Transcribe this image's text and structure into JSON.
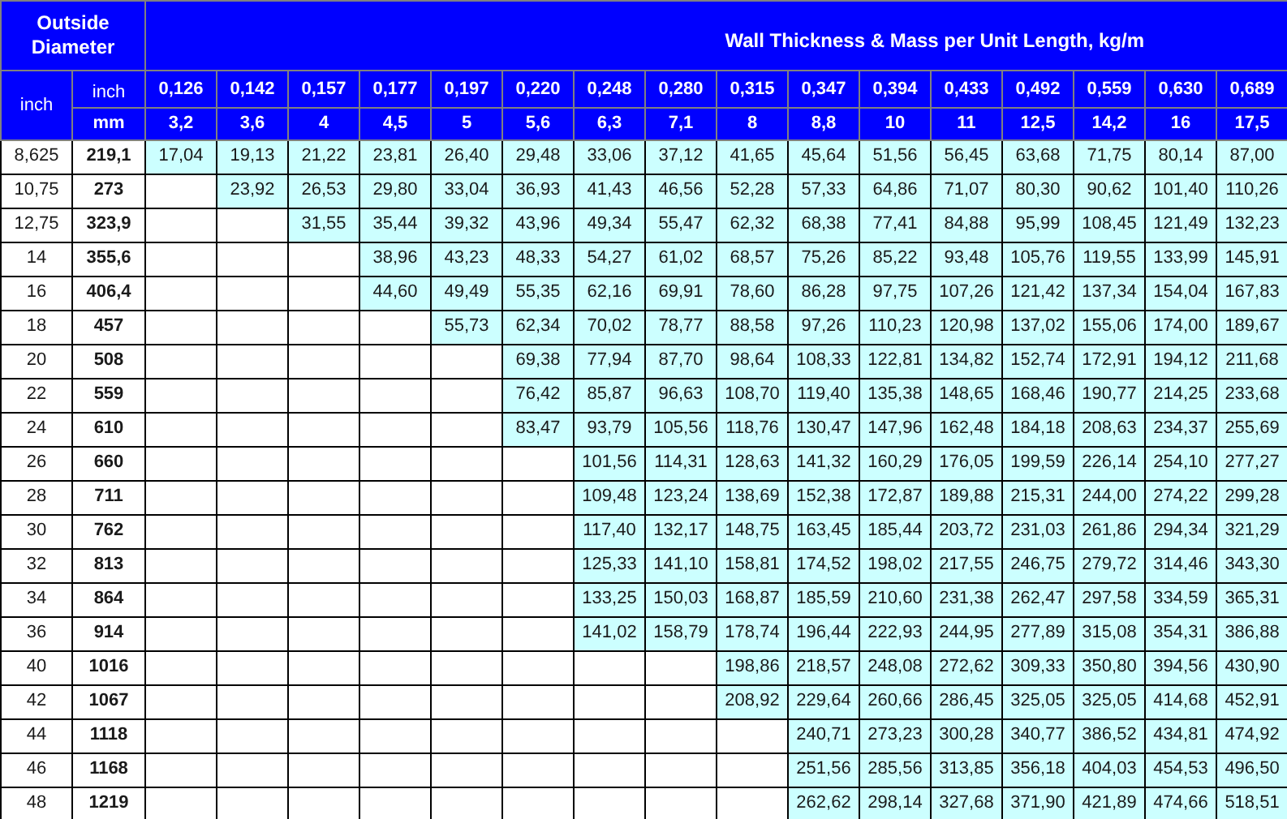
{
  "header": {
    "diameter_title": "Outside Diameter",
    "wall_title": "Wall Thickness & Mass per Unit Length, kg/m",
    "diameter_unit": "inch",
    "inch_label": "inch",
    "mm_label": "mm"
  },
  "thickness": [
    {
      "inch": "0,126",
      "mm": "3,2"
    },
    {
      "inch": "0,142",
      "mm": "3,6"
    },
    {
      "inch": "0,157",
      "mm": "4"
    },
    {
      "inch": "0,177",
      "mm": "4,5"
    },
    {
      "inch": "0,197",
      "mm": "5"
    },
    {
      "inch": "0,220",
      "mm": "5,6"
    },
    {
      "inch": "0,248",
      "mm": "6,3"
    },
    {
      "inch": "0,280",
      "mm": "7,1"
    },
    {
      "inch": "0,315",
      "mm": "8"
    },
    {
      "inch": "0,347",
      "mm": "8,8"
    },
    {
      "inch": "0,394",
      "mm": "10"
    },
    {
      "inch": "0,433",
      "mm": "11"
    },
    {
      "inch": "0,492",
      "mm": "12,5"
    },
    {
      "inch": "0,559",
      "mm": "14,2"
    },
    {
      "inch": "0,630",
      "mm": "16"
    },
    {
      "inch": "0,689",
      "mm": "17,5"
    }
  ],
  "rows": [
    {
      "inch": "8,625",
      "mm": "219,1",
      "cells": [
        "17,04",
        "19,13",
        "21,22",
        "23,81",
        "26,40",
        "29,48",
        "33,06",
        "37,12",
        "41,65",
        "45,64",
        "51,56",
        "56,45",
        "63,68",
        "71,75",
        "80,14",
        "87,00"
      ]
    },
    {
      "inch": "10,75",
      "mm": "273",
      "cells": [
        null,
        "23,92",
        "26,53",
        "29,80",
        "33,04",
        "36,93",
        "41,43",
        "46,56",
        "52,28",
        "57,33",
        "64,86",
        "71,07",
        "80,30",
        "90,62",
        "101,40",
        "110,26"
      ]
    },
    {
      "inch": "12,75",
      "mm": "323,9",
      "cells": [
        null,
        null,
        "31,55",
        "35,44",
        "39,32",
        "43,96",
        "49,34",
        "55,47",
        "62,32",
        "68,38",
        "77,41",
        "84,88",
        "95,99",
        "108,45",
        "121,49",
        "132,23"
      ]
    },
    {
      "inch": "14",
      "mm": "355,6",
      "cells": [
        null,
        null,
        null,
        "38,96",
        "43,23",
        "48,33",
        "54,27",
        "61,02",
        "68,57",
        "75,26",
        "85,22",
        "93,48",
        "105,76",
        "119,55",
        "133,99",
        "145,91"
      ]
    },
    {
      "inch": "16",
      "mm": "406,4",
      "cells": [
        null,
        null,
        null,
        "44,60",
        "49,49",
        "55,35",
        "62,16",
        "69,91",
        "78,60",
        "86,28",
        "97,75",
        "107,26",
        "121,42",
        "137,34",
        "154,04",
        "167,83"
      ]
    },
    {
      "inch": "18",
      "mm": "457",
      "cells": [
        null,
        null,
        null,
        null,
        "55,73",
        "62,34",
        "70,02",
        "78,77",
        "88,58",
        "97,26",
        "110,23",
        "120,98",
        "137,02",
        "155,06",
        "174,00",
        "189,67"
      ]
    },
    {
      "inch": "20",
      "mm": "508",
      "cells": [
        null,
        null,
        null,
        null,
        null,
        "69,38",
        "77,94",
        "87,70",
        "98,64",
        "108,33",
        "122,81",
        "134,82",
        "152,74",
        "172,91",
        "194,12",
        "211,68"
      ]
    },
    {
      "inch": "22",
      "mm": "559",
      "cells": [
        null,
        null,
        null,
        null,
        null,
        "76,42",
        "85,87",
        "96,63",
        "108,70",
        "119,40",
        "135,38",
        "148,65",
        "168,46",
        "190,77",
        "214,25",
        "233,68"
      ]
    },
    {
      "inch": "24",
      "mm": "610",
      "cells": [
        null,
        null,
        null,
        null,
        null,
        "83,47",
        "93,79",
        "105,56",
        "118,76",
        "130,47",
        "147,96",
        "162,48",
        "184,18",
        "208,63",
        "234,37",
        "255,69"
      ]
    },
    {
      "inch": "26",
      "mm": "660",
      "cells": [
        null,
        null,
        null,
        null,
        null,
        null,
        "101,56",
        "114,31",
        "128,63",
        "141,32",
        "160,29",
        "176,05",
        "199,59",
        "226,14",
        "254,10",
        "277,27"
      ]
    },
    {
      "inch": "28",
      "mm": "711",
      "cells": [
        null,
        null,
        null,
        null,
        null,
        null,
        "109,48",
        "123,24",
        "138,69",
        "152,38",
        "172,87",
        "189,88",
        "215,31",
        "244,00",
        "274,22",
        "299,28"
      ]
    },
    {
      "inch": "30",
      "mm": "762",
      "cells": [
        null,
        null,
        null,
        null,
        null,
        null,
        "117,40",
        "132,17",
        "148,75",
        "163,45",
        "185,44",
        "203,72",
        "231,03",
        "261,86",
        "294,34",
        "321,29"
      ]
    },
    {
      "inch": "32",
      "mm": "813",
      "cells": [
        null,
        null,
        null,
        null,
        null,
        null,
        "125,33",
        "141,10",
        "158,81",
        "174,52",
        "198,02",
        "217,55",
        "246,75",
        "279,72",
        "314,46",
        "343,30"
      ]
    },
    {
      "inch": "34",
      "mm": "864",
      "cells": [
        null,
        null,
        null,
        null,
        null,
        null,
        "133,25",
        "150,03",
        "168,87",
        "185,59",
        "210,60",
        "231,38",
        "262,47",
        "297,58",
        "334,59",
        "365,31"
      ]
    },
    {
      "inch": "36",
      "mm": "914",
      "cells": [
        null,
        null,
        null,
        null,
        null,
        null,
        "141,02",
        "158,79",
        "178,74",
        "196,44",
        "222,93",
        "244,95",
        "277,89",
        "315,08",
        "354,31",
        "386,88"
      ]
    },
    {
      "inch": "40",
      "mm": "1016",
      "cells": [
        null,
        null,
        null,
        null,
        null,
        null,
        null,
        null,
        "198,86",
        "218,57",
        "248,08",
        "272,62",
        "309,33",
        "350,80",
        "394,56",
        "430,90"
      ]
    },
    {
      "inch": "42",
      "mm": "1067",
      "cells": [
        null,
        null,
        null,
        null,
        null,
        null,
        null,
        null,
        "208,92",
        "229,64",
        "260,66",
        "286,45",
        "325,05",
        "325,05",
        "414,68",
        "452,91"
      ]
    },
    {
      "inch": "44",
      "mm": "1118",
      "cells": [
        null,
        null,
        null,
        null,
        null,
        null,
        null,
        null,
        null,
        "240,71",
        "273,23",
        "300,28",
        "340,77",
        "386,52",
        "434,81",
        "474,92"
      ]
    },
    {
      "inch": "46",
      "mm": "1168",
      "cells": [
        null,
        null,
        null,
        null,
        null,
        null,
        null,
        null,
        null,
        "251,56",
        "285,56",
        "313,85",
        "356,18",
        "404,03",
        "454,53",
        "496,50"
      ]
    },
    {
      "inch": "48",
      "mm": "1219",
      "cells": [
        null,
        null,
        null,
        null,
        null,
        null,
        null,
        null,
        null,
        "262,62",
        "298,14",
        "327,68",
        "371,90",
        "421,89",
        "474,66",
        "518,51"
      ]
    }
  ]
}
